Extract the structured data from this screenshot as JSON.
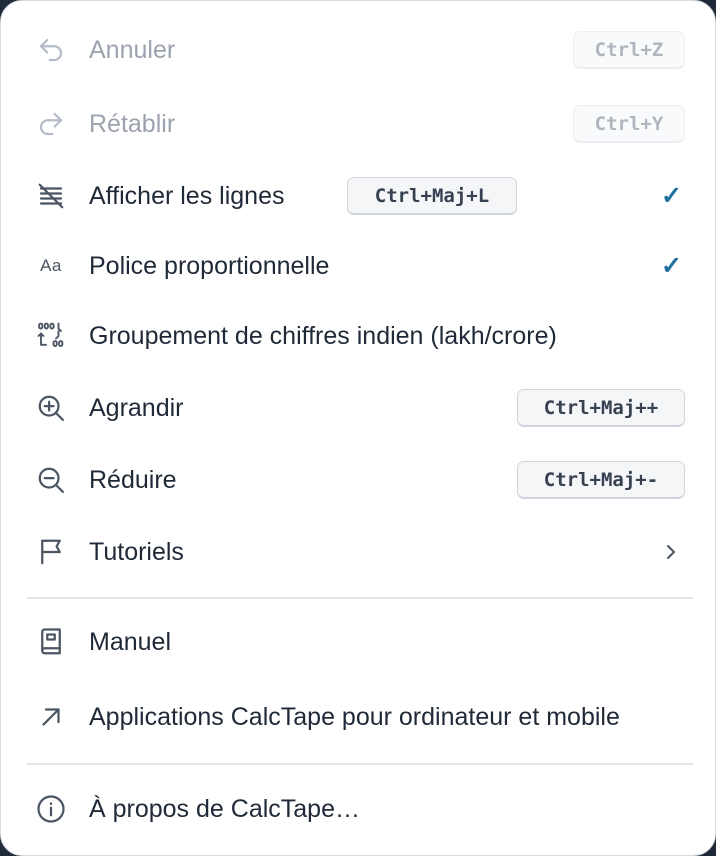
{
  "menu": {
    "undo": {
      "label": "Annuler",
      "shortcut": "Ctrl+Z",
      "icon": "undo-icon"
    },
    "redo": {
      "label": "Rétablir",
      "shortcut": "Ctrl+Y",
      "icon": "redo-icon"
    },
    "show_lines": {
      "label": "Afficher les lignes",
      "shortcut": "Ctrl+Maj+L",
      "check": "✓",
      "icon": "lines-icon"
    },
    "proportional_font": {
      "label": "Police proportionnelle",
      "icon_text": "Aa",
      "check": "✓",
      "icon": "font-icon"
    },
    "indian_grouping": {
      "label": "Groupement de chiffres indien (lakh/crore)",
      "icon": "digit-grouping-icon"
    },
    "zoom_in": {
      "label": "Agrandir",
      "shortcut": "Ctrl+Maj++",
      "icon": "zoom-in-icon"
    },
    "zoom_out": {
      "label": "Réduire",
      "shortcut": "Ctrl+Maj+-",
      "icon": "zoom-out-icon"
    },
    "tutorials": {
      "label": "Tutoriels",
      "icon": "flag-icon"
    },
    "manual": {
      "label": "Manuel",
      "icon": "book-icon"
    },
    "apps": {
      "label": "Applications CalcTape pour ordinateur et mobile",
      "icon": "external-arrow-icon"
    },
    "about": {
      "label": "À propos de CalcTape…",
      "icon": "info-icon"
    }
  },
  "colors": {
    "check": "#1f6f9f",
    "text": "#1f2937",
    "disabled_text": "#9ca3af"
  }
}
